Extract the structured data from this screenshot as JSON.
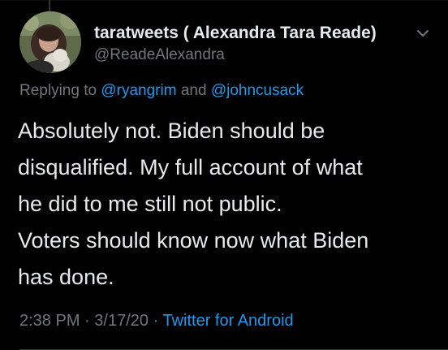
{
  "tweet": {
    "author": {
      "display_name": "taratweets ( Alexandra Tara Reade)",
      "handle": "@ReadeAlexandra",
      "avatar_icon": "profile-photo"
    },
    "menu_icon": "chevron-down-icon",
    "reply": {
      "prefix": "Replying to",
      "mention_1": "@ryangrim",
      "joiner": "and",
      "mention_2": "@johncusack"
    },
    "text_lines": [
      "Absolutely not. Biden should be",
      "disqualified. My full account of what",
      "he did to me still not public.",
      "Voters should know now what Biden",
      "has done."
    ],
    "meta": {
      "time": "2:38 PM",
      "separator": "·",
      "date": "3/17/20",
      "source": "Twitter for Android"
    }
  },
  "colors": {
    "background": "#000000",
    "primary_text": "#e7e9ea",
    "secondary_text": "#71767b",
    "accent_link": "#1d9bf0"
  }
}
